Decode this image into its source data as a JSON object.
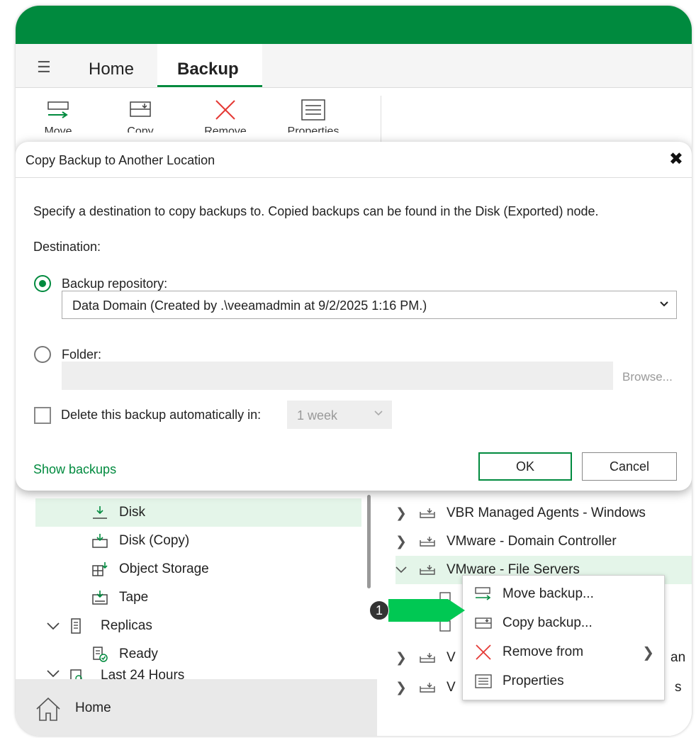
{
  "colors": {
    "brand_green": "#008a3e",
    "selection": "#e4f5e9",
    "callout_arrow": "#00c853"
  },
  "tabs": {
    "home": "Home",
    "backup": "Backup"
  },
  "ribbon": {
    "move": "Move",
    "copy": "Copy",
    "remove": "Remove",
    "properties": "Properties"
  },
  "dialog": {
    "title": "Copy Backup to Another Location",
    "description": "Specify a destination to copy backups to. Copied backups can be found in the Disk (Exported) node.",
    "destination_label": "Destination:",
    "repo_option_label": "Backup repository:",
    "repo_selected": "Data Domain (Created by .\\veeamadmin at 9/2/2025 1:16 PM.)",
    "folder_option_label": "Folder:",
    "folder_value": "",
    "browse_label": "Browse...",
    "delete_label": "Delete this backup automatically in:",
    "delete_period": "1 week",
    "show_backups": "Show backups",
    "ok": "OK",
    "cancel": "Cancel"
  },
  "left_tree": {
    "disk": "Disk",
    "disk_copy": "Disk (Copy)",
    "object_storage": "Object Storage",
    "tape": "Tape",
    "replicas": "Replicas",
    "ready": "Ready",
    "last24": "Last 24 Hours"
  },
  "navbar": {
    "home": "Home"
  },
  "right_list": {
    "item1": "VBR Managed Agents - Windows",
    "item2": "VMware - Domain Controller",
    "item3": "VMware - File Servers",
    "item4_tail": "an",
    "item5_tail": "s"
  },
  "context_menu": {
    "move": "Move backup...",
    "copy": "Copy backup...",
    "remove": "Remove from",
    "properties": "Properties"
  },
  "callout": {
    "number": "1"
  }
}
